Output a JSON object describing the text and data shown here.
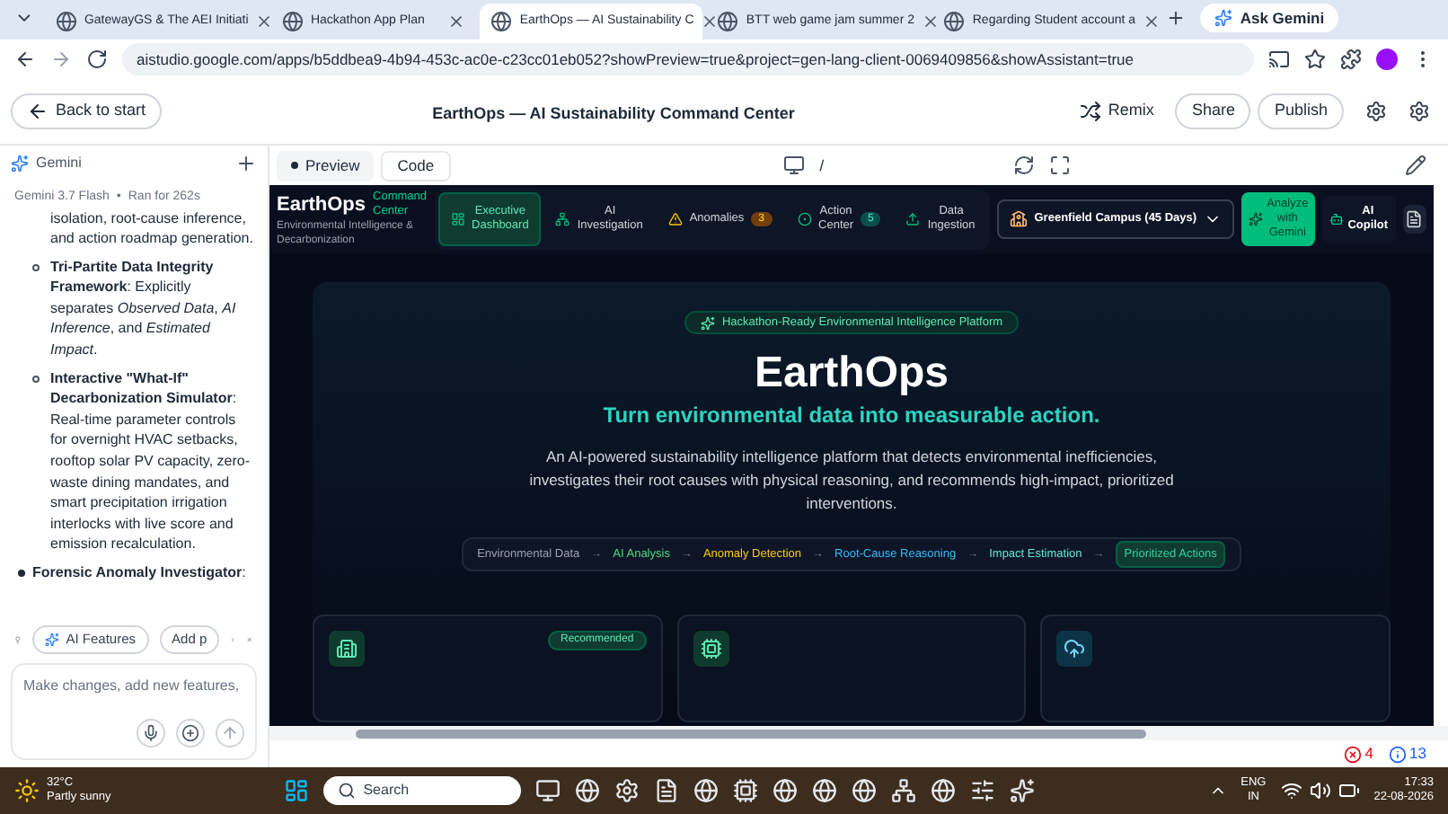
{
  "browser": {
    "tabs": [
      {
        "title": "GatewayGS & The AEI Initiati",
        "selected": false
      },
      {
        "title": "Hackathon App Plan",
        "selected": false
      },
      {
        "title": "EarthOps — AI Sustainability C",
        "selected": true
      },
      {
        "title": "BTT web game jam summer 2",
        "selected": false
      },
      {
        "title": "Regarding Student account a",
        "selected": false
      }
    ],
    "ask_gemini": "Ask Gemini",
    "url": "aistudio.google.com/apps/b5ddbea9-4b94-453c-ac0e-c23cc01eb052?showPreview=true&project=gen-lang-client-0069409856&showAssistant=true"
  },
  "app_header": {
    "back": "Back to start",
    "title": "EarthOps — AI Sustainability Command Center",
    "remix": "Remix",
    "buttons": [
      "Share",
      "Publish"
    ]
  },
  "sidebar": {
    "title": "Gemini",
    "model": "Gemini 3.7 Flash",
    "run": "Ran for 262s",
    "separator": "•",
    "items": [
      {
        "kind": "continuation",
        "text": "isolation, root-cause inference, and action roadmap generation."
      },
      {
        "kind": "sub",
        "text": "**Tri-Partite Data Integrity Framework**: Explicitly separates *Observed Data*, *AI Inference*, and *Estimated Impact*."
      },
      {
        "kind": "sub",
        "text": "**Interactive \"What-If\" Decarbonization Simulator**: Real-time parameter controls for overnight HVAC setbacks, rooftop solar PV capacity, zero-waste dining mandates, and smart precipitation irrigation interlocks with live score and emission recalculation."
      },
      {
        "kind": "bullet",
        "text": "**Forensic Anomaly Investigator**:"
      }
    ],
    "chips": [
      "AI Features",
      "Add p"
    ],
    "prompt_placeholder": "Make changes, add new features,"
  },
  "preview_bar": {
    "tabs": [
      {
        "label": "Preview",
        "selected": true
      },
      {
        "label": "Code",
        "selected": false
      }
    ],
    "path": "/"
  },
  "app": {
    "brand": "EarthOps",
    "brand_sub": "Command Center",
    "tagline": "Environmental Intelligence & Decarbonization",
    "nav": [
      {
        "label": "Executive Dashboard",
        "selected": true
      },
      {
        "label": "AI Investigation",
        "selected": false
      },
      {
        "label": "Anomalies",
        "badge": "3",
        "selected": false
      },
      {
        "label": "Action Center",
        "badge": "5",
        "selected": false
      },
      {
        "label": "Data Ingestion",
        "selected": false
      }
    ],
    "campus": "Greenfield Campus (45 Days)",
    "analyze": "Analyze with Gemini",
    "copilot": "AI Copilot",
    "pill": "Hackathon-Ready Environmental Intelligence Platform",
    "title": "EarthOps",
    "subtitle": "Turn environmental data into measurable action.",
    "description": "An AI-powered sustainability intelligence platform that detects environmental inefficiencies, investigates their root causes with physical reasoning, and recommends high-impact, prioritized interventions.",
    "pipeline": [
      {
        "label": "Environmental Data",
        "color": "#9ca3af",
        "selected": false
      },
      {
        "label": "AI Analysis",
        "color": "#4ade80",
        "selected": false
      },
      {
        "label": "Anomaly Detection",
        "color": "#facc15",
        "selected": false
      },
      {
        "label": "Root-Cause Reasoning",
        "color": "#38bdf8",
        "selected": false
      },
      {
        "label": "Impact Estimation",
        "color": "#5eead4",
        "selected": false
      },
      {
        "label": "Prioritized Actions",
        "color": "#34d399",
        "selected": true
      }
    ],
    "arrow": "→",
    "cards": [
      {
        "kind": "building",
        "badge": "Recommended"
      },
      {
        "kind": "chip"
      },
      {
        "kind": "upload"
      }
    ]
  },
  "status": {
    "errors": "4",
    "info": "13"
  },
  "taskbar": {
    "temp": "32°C",
    "weather": "Partly sunny",
    "search": "Search",
    "lang": "ENG",
    "region": "IN",
    "time": "17:33",
    "date": "22-08-2026"
  }
}
